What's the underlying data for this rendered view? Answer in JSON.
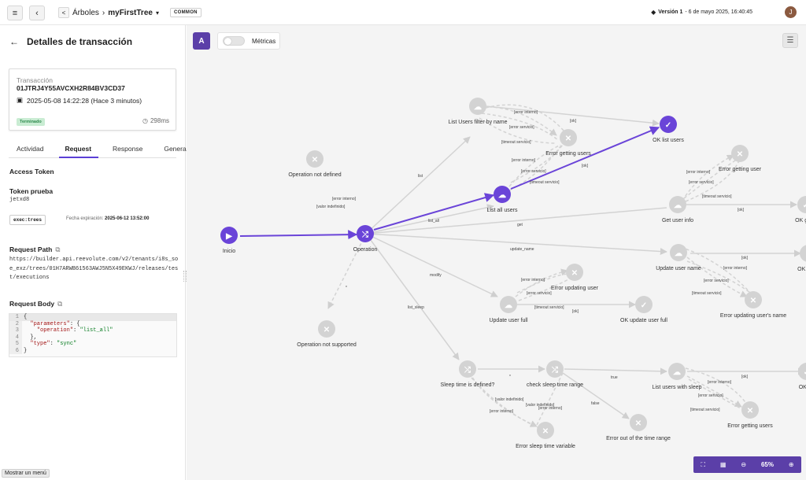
{
  "header": {
    "menu_icon": "menu-icon",
    "back_icon": "chevron-left-icon",
    "share_icon": "share-icon",
    "breadcrumb_root": "Árboles",
    "breadcrumb_sep": "›",
    "tree_name": "myFirstTree",
    "tree_dropdown": "▾",
    "tag": "COMMON",
    "version_icon": "tag-icon",
    "version_label": "Versión 1",
    "version_date": "- 6 de mayo 2025, 16:40:45",
    "avatar_initial": "J"
  },
  "panel": {
    "back_icon": "arrow-left-icon",
    "title": "Detalles de transacción",
    "transaction_label": "Transacción",
    "transaction_id": "01JTRJ4Y55AVCXH2R84BV3CD37",
    "transaction_date": "2025-05-08 14:22:28 (Hace 3 minutos)",
    "status": "Terminado",
    "duration": "298ms",
    "tabs": [
      "Actividad",
      "Request",
      "Response",
      "General"
    ],
    "active_tab": "Request",
    "access_token_heading": "Access Token",
    "token_name": "Token prueba",
    "token_id": "jetxd8",
    "scope": "exec:trees",
    "expiry_label": "Fecha expiración:",
    "expiry_value": "2025-06-12 13:52:00",
    "request_path_heading": "Request Path",
    "request_path": "https://builder.api.reevolute.com/v2/tenants/i8s_soe_exz/trees/01H7ARWB61563AWJ5N5X49EKWJ/releases/test/executions",
    "request_body_heading": "Request Body",
    "code_lines": [
      {
        "n": "1",
        "pre": "{",
        "key": "",
        "mid": "",
        "val": ""
      },
      {
        "n": "2",
        "pre": "  ",
        "key": "\"parameters\"",
        "mid": ": {",
        "val": ""
      },
      {
        "n": "3",
        "pre": "    ",
        "key": "\"operation\"",
        "mid": ": ",
        "val": "\"list_all\""
      },
      {
        "n": "4",
        "pre": "  },",
        "key": "",
        "mid": "",
        "val": ""
      },
      {
        "n": "5",
        "pre": "  ",
        "key": "\"type\"",
        "mid": ": ",
        "val": "\"sync\""
      },
      {
        "n": "6",
        "pre": "}",
        "key": "",
        "mid": "",
        "val": ""
      }
    ],
    "show_menu": "Mostrar un menú"
  },
  "canvas": {
    "logo_letter": "A",
    "metrics_label": "Métricas",
    "filter_icon": "sliders-icon",
    "zoom": "65%",
    "zoom_icons": [
      "fullscreen-icon",
      "map-icon",
      "zoom-out-icon",
      "zoom-in-icon"
    ],
    "colors": {
      "primary": "#5b3fa8",
      "node": "#d3d3d3",
      "edge": "#d0d0d0"
    }
  },
  "graph": {
    "nodes": [
      {
        "label": "Inicio",
        "icon": "play-icon",
        "active": true
      },
      {
        "label": "Operation",
        "icon": "switch-icon",
        "active": true
      },
      {
        "label": "Operation not defined",
        "icon": "close-icon"
      },
      {
        "label": "Operation not supported",
        "icon": "close-icon"
      },
      {
        "label": "List Users filter by name",
        "icon": "cloud-icon"
      },
      {
        "label": "Error getting users",
        "icon": "close-icon"
      },
      {
        "label": "OK list users",
        "icon": "check-icon",
        "active": true
      },
      {
        "label": "List all users",
        "icon": "cloud-icon",
        "active": true
      },
      {
        "label": "Get user info",
        "icon": "cloud-icon"
      },
      {
        "label": "Error getting user",
        "icon": "close-icon"
      },
      {
        "label": "OK get u",
        "icon": "check-icon"
      },
      {
        "label": "Update user name",
        "icon": "cloud-icon"
      },
      {
        "label": "OK upda",
        "icon": "check-icon"
      },
      {
        "label": "Error updating user's name",
        "icon": "close-icon"
      },
      {
        "label": "Update user full",
        "icon": "cloud-icon"
      },
      {
        "label": "Error updating user",
        "icon": "close-icon"
      },
      {
        "label": "OK update user full",
        "icon": "check-icon"
      },
      {
        "label": "Sleep time is defined?",
        "icon": "switch-icon"
      },
      {
        "label": "check sleep time range",
        "icon": "switch-icon"
      },
      {
        "label": "List users with sleep",
        "icon": "cloud-icon"
      },
      {
        "label": "OK list",
        "icon": "check-icon"
      },
      {
        "label": "Error getting users",
        "icon": "close-icon"
      },
      {
        "label": "Error out of the time range",
        "icon": "close-icon"
      },
      {
        "label": "Error sleep time variable",
        "icon": "close-icon"
      }
    ],
    "edge_labels": {
      "list": "list",
      "list_all": "list_all",
      "get": "get",
      "update_name": "update_name",
      "modify": "modify",
      "list_sleep": "list_sleep",
      "star": "*",
      "error_interno": "[error interno]",
      "valor_indefinido": "[valor indefinido]",
      "error_servicio": "[error servicio]",
      "timeout_servicio": "[timeout servicio]",
      "ok": "[ok]",
      "true": "true",
      "false": "false"
    }
  }
}
